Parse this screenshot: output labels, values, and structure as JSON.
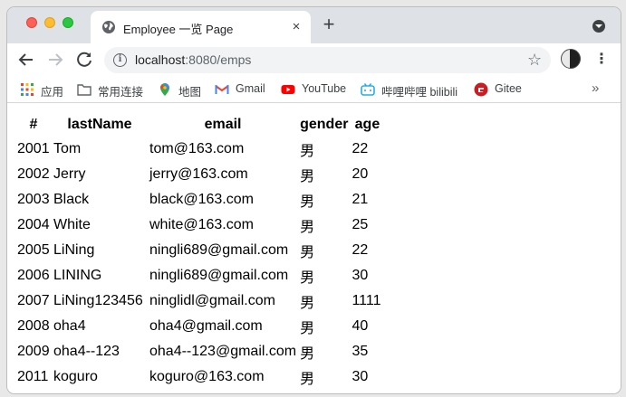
{
  "browser": {
    "tab": {
      "title": "Employee 一览 Page",
      "favicon": "globe-icon",
      "close": "×"
    },
    "new_tab": "+",
    "url": {
      "host": "localhost",
      "rest": ":8080/emps"
    },
    "bookmarks": [
      {
        "label": "应用",
        "icon": "apps-grid-icon"
      },
      {
        "label": "常用连接",
        "icon": "folder-icon"
      },
      {
        "label": "地图",
        "icon": "maps-pin-icon"
      },
      {
        "label": "Gmail",
        "icon": "gmail-icon"
      },
      {
        "label": "YouTube",
        "icon": "youtube-icon"
      },
      {
        "label": "哔哩哔哩 bilibili",
        "icon": "bilibili-icon"
      },
      {
        "label": "Gitee",
        "icon": "gitee-icon"
      }
    ],
    "bookmarks_more": "»"
  },
  "table": {
    "headers": [
      "#",
      "lastName",
      "email",
      "gender",
      "age"
    ],
    "rows": [
      [
        "2001",
        "Tom",
        "tom@163.com",
        "男",
        "22"
      ],
      [
        "2002",
        "Jerry",
        "jerry@163.com",
        "男",
        "20"
      ],
      [
        "2003",
        "Black",
        "black@163.com",
        "男",
        "21"
      ],
      [
        "2004",
        "White",
        "white@163.com",
        "男",
        "25"
      ],
      [
        "2005",
        "LiNing",
        "ningli689@gmail.com",
        "男",
        "22"
      ],
      [
        "2006",
        "LINING",
        "ningli689@gmail.com",
        "男",
        "30"
      ],
      [
        "2007",
        "LiNing123456",
        "ninglidl@gmail.com",
        "男",
        "1111"
      ],
      [
        "2008",
        "oha4",
        "oha4@gmail.com",
        "男",
        "40"
      ],
      [
        "2009",
        "oha4--123",
        "oha4--123@gmail.com",
        "男",
        "35"
      ],
      [
        "2011",
        "koguro",
        "koguro@163.com",
        "男",
        "30"
      ]
    ]
  },
  "colors": {
    "tabstrip": "#dee1e6",
    "omnibox": "#f1f3f4",
    "text": "#000000"
  }
}
